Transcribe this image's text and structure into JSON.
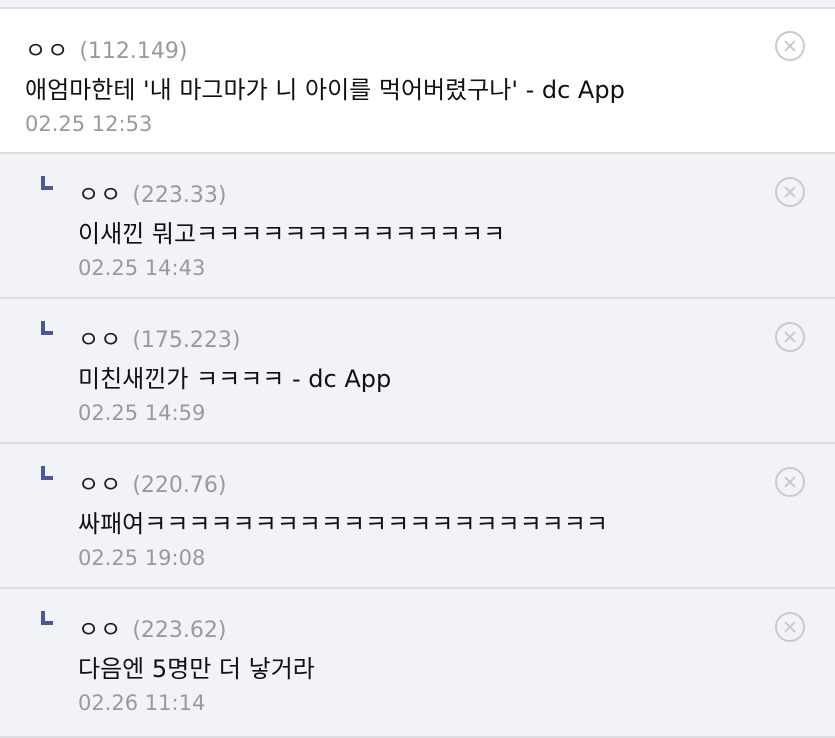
{
  "comments": [
    {
      "nick": "ㅇㅇ",
      "ip": "(112.149)",
      "text": "애엄마한테 '내 마그마가 니 아이를 먹어버렸구나' - dc App",
      "date": "02.25 12:53"
    }
  ],
  "replies": [
    {
      "nick": "ㅇㅇ",
      "ip": "(223.33)",
      "text": "이새낀 뭐고ㅋㅋㅋㅋㅋㅋㅋㅋㅋㅋㅋㅋㅋㅋ",
      "date": "02.25 14:43"
    },
    {
      "nick": "ㅇㅇ",
      "ip": "(175.223)",
      "text": "미친새낀가 ㅋㅋㅋㅋ - dc App",
      "date": "02.25 14:59"
    },
    {
      "nick": "ㅇㅇ",
      "ip": "(220.76)",
      "text": "싸패여ㅋㅋㅋㅋㅋㅋㅋㅋㅋㅋㅋㅋㅋㅋㅋㅋㅋㅋㅋㅋㅋ",
      "date": "02.25 19:08"
    },
    {
      "nick": "ㅇㅇ",
      "ip": "(223.62)",
      "text": "다음엔 5명만 더 낳거라",
      "date": "02.26 11:14"
    }
  ],
  "icons": {
    "reply": "reply-arrow-icon",
    "delete": "close-circle-icon"
  },
  "colors": {
    "reply_background": "#f2f3f7",
    "reply_mark": "#4b5798",
    "meta_text": "#9a9a9a"
  }
}
